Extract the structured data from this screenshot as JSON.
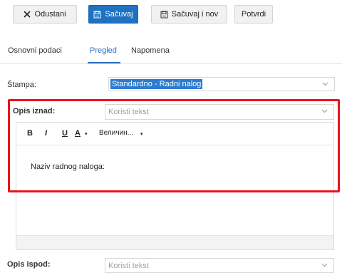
{
  "toolbar": {
    "cancel_label": "Odustani",
    "save_label": "Sačuvaj",
    "save_new_label": "Sačuvaj i nov",
    "confirm_label": "Potvrdi"
  },
  "tabs": [
    {
      "label": "Osnovni podaci",
      "active": false
    },
    {
      "label": "Pregled",
      "active": true
    },
    {
      "label": "Napomena",
      "active": false
    }
  ],
  "form": {
    "stampa": {
      "label": "Štampa:",
      "value": "Standardno - Radni nalog"
    },
    "opis_iznad": {
      "label": "Opis iznad:",
      "value": "Koristi tekst"
    },
    "opis_ispod": {
      "label": "Opis ispod:",
      "value": "Koristi tekst"
    }
  },
  "editor": {
    "bold_label": "B",
    "italic_label": "I",
    "underline_label": "U",
    "font_color_label": "A",
    "caret_symbol": "▾",
    "size_label": "Величин...",
    "content": "Naziv radnog naloga:"
  },
  "colors": {
    "primary": "#1f71c1",
    "tab_active": "#2a72c4",
    "highlight": "#e8141c"
  },
  "icons": [
    "close-icon",
    "save-icon",
    "save-new-icon",
    "chevron-down-icon"
  ]
}
